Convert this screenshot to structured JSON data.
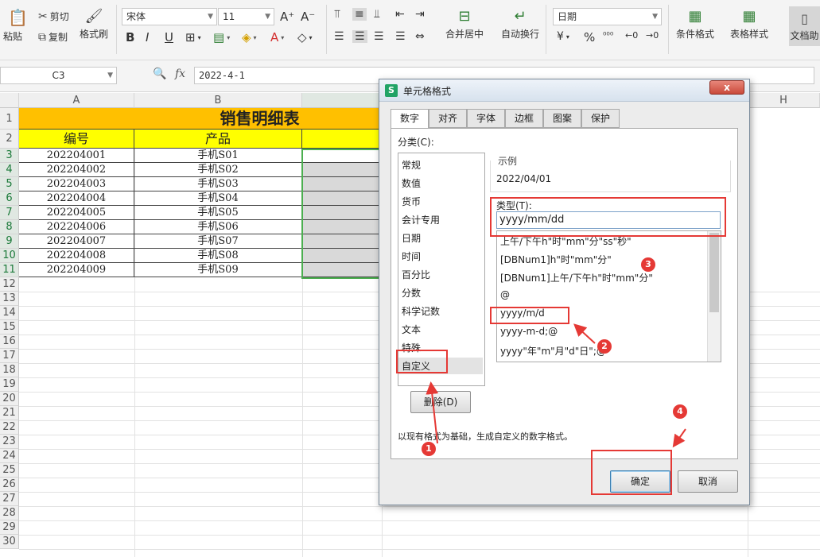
{
  "ribbon": {
    "paste": "粘贴",
    "cut": "剪切",
    "copy": "复制",
    "format_painter": "格式刷",
    "font_name": "宋体",
    "font_size": "11",
    "merge_center": "合并居中",
    "auto_wrap": "自动换行",
    "number_format": "日期",
    "conditional_format": "条件格式",
    "table_style": "表格样式",
    "doc_assist": "文档助"
  },
  "formula_bar": {
    "name_box": "C3",
    "fx": "fx",
    "value": "2022-4-1"
  },
  "columns": [
    "A",
    "B",
    "H"
  ],
  "rows": [
    "1",
    "2",
    "3",
    "4",
    "5",
    "6",
    "7",
    "8",
    "9",
    "10",
    "11",
    "12",
    "13",
    "14",
    "15",
    "16",
    "17",
    "18",
    "19",
    "20",
    "21",
    "22",
    "23",
    "24",
    "25",
    "26",
    "27",
    "28",
    "29",
    "30"
  ],
  "sheet": {
    "title": "销售明细表",
    "header_a": "编号",
    "header_b": "产品",
    "data": [
      [
        "202204001",
        "手机S01"
      ],
      [
        "202204002",
        "手机S02"
      ],
      [
        "202204003",
        "手机S03"
      ],
      [
        "202204004",
        "手机S04"
      ],
      [
        "202204005",
        "手机S05"
      ],
      [
        "202204006",
        "手机S06"
      ],
      [
        "202204007",
        "手机S07"
      ],
      [
        "202204008",
        "手机S08"
      ],
      [
        "202204009",
        "手机S09"
      ]
    ]
  },
  "dialog": {
    "title": "单元格格式",
    "close": "x",
    "tabs": [
      "数字",
      "对齐",
      "字体",
      "边框",
      "图案",
      "保护"
    ],
    "category_label": "分类(C):",
    "categories": [
      "常规",
      "数值",
      "货币",
      "会计专用",
      "日期",
      "时间",
      "百分比",
      "分数",
      "科学记数",
      "文本",
      "特殊",
      "自定义"
    ],
    "sample_label": "示例",
    "sample_value": "2022/04/01",
    "type_label": "类型(T):",
    "type_value": "yyyy/mm/dd",
    "type_list": [
      "上午/下午h\"时\"mm\"分\"ss\"秒\"",
      "[DBNum1]h\"时\"mm\"分\"",
      "[DBNum1]上午/下午h\"时\"mm\"分\"",
      "@",
      "yyyy/m/d",
      "yyyy-m-d;@",
      "yyyy\"年\"m\"月\"d\"日\";@"
    ],
    "delete_button": "删除(D)",
    "hint": "以现有格式为基础，生成自定义的数字格式。",
    "ok_button": "确定",
    "cancel_button": "取消"
  },
  "annotations": [
    "1",
    "2",
    "3",
    "4"
  ],
  "colors": {
    "title_fill": "#ffc000",
    "header_fill": "#ffff00",
    "highlight": "#e53935",
    "selection": "#4caf50"
  }
}
